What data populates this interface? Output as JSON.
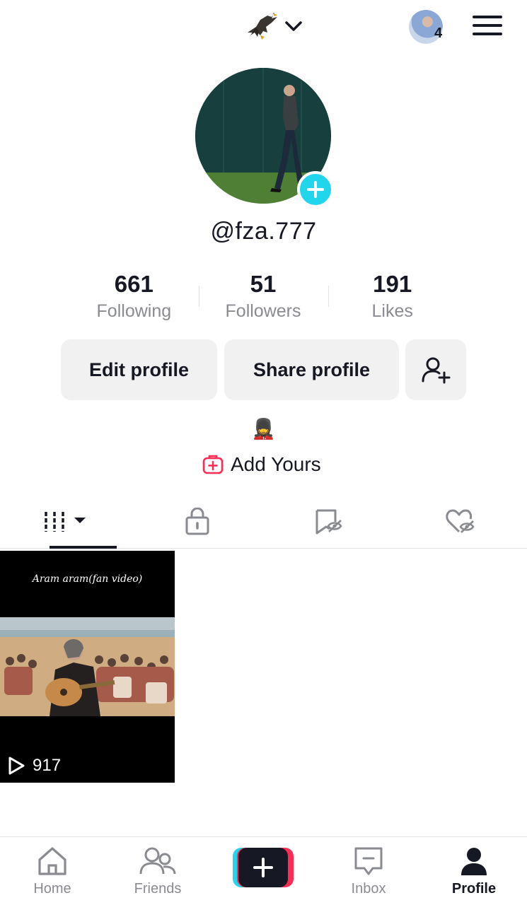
{
  "header": {
    "account_switcher_icon": "eagle-emoji",
    "notification_count": "4"
  },
  "profile": {
    "username": "@fza.777",
    "stats": [
      {
        "value": "661",
        "label": "Following"
      },
      {
        "value": "51",
        "label": "Followers"
      },
      {
        "value": "191",
        "label": "Likes"
      }
    ],
    "buttons": {
      "edit": "Edit profile",
      "share": "Share profile"
    },
    "bio_emoji": "💂‍♀️",
    "add_yours_label": "Add Yours"
  },
  "tabs": [
    {
      "icon": "grid-icon",
      "active": true
    },
    {
      "icon": "lock-icon",
      "active": false
    },
    {
      "icon": "hidden-bookmark-icon",
      "active": false
    },
    {
      "icon": "hidden-heart-icon",
      "active": false
    }
  ],
  "videos": [
    {
      "caption": "Aram aram(fan video)",
      "views": "917"
    }
  ],
  "bottom_nav": {
    "home": "Home",
    "friends": "Friends",
    "inbox": "Inbox",
    "profile": "Profile"
  },
  "colors": {
    "accent_cyan": "#20d5ec",
    "accent_red": "#fe2c55",
    "text_dark": "#161823",
    "text_muted": "#8a8b91",
    "button_bg": "#f1f1f2"
  }
}
